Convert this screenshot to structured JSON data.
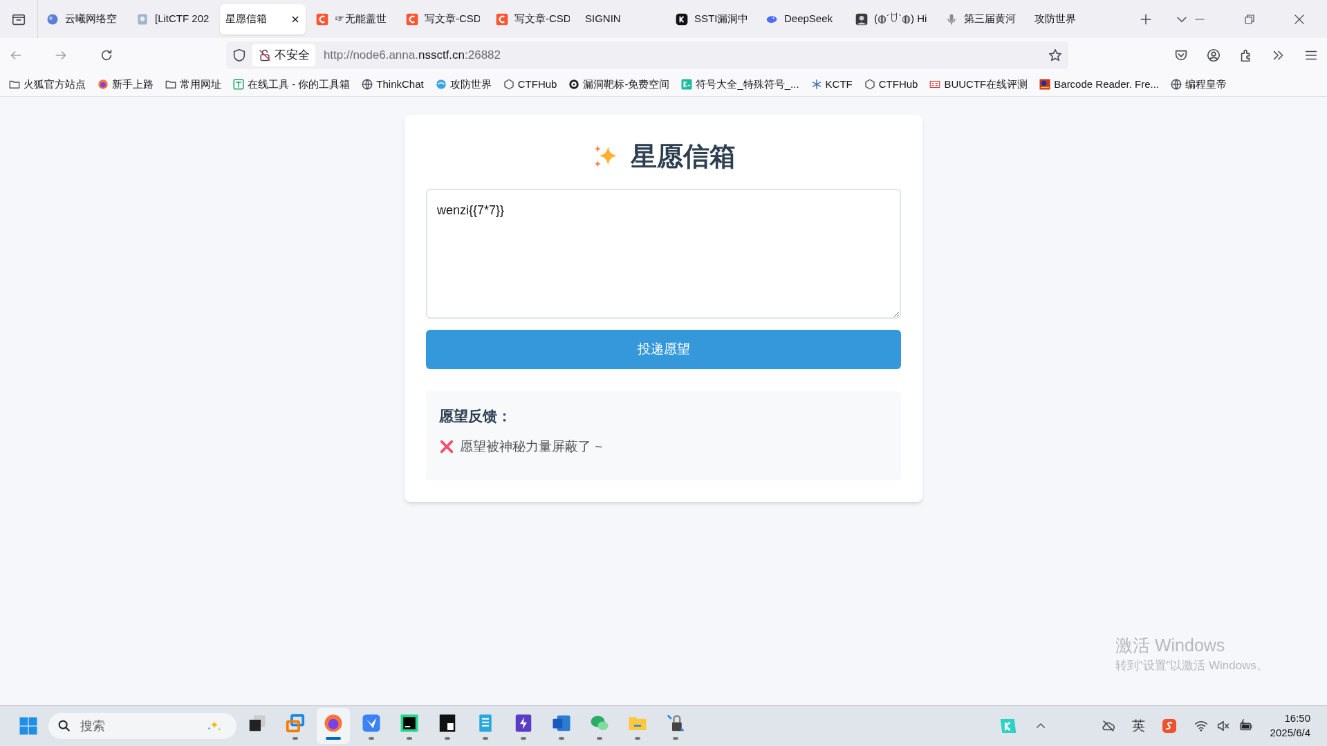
{
  "browser": {
    "tabs": [
      {
        "title": "云曦网络空",
        "kind": "cloud",
        "selected": false
      },
      {
        "title": "[LitCTF 202",
        "kind": "doc",
        "selected": false
      },
      {
        "title": "星愿信箱",
        "kind": "plain",
        "selected": true
      },
      {
        "title": "☞无能盖世",
        "kind": "c",
        "selected": false
      },
      {
        "title": "写文章-CSD",
        "kind": "c",
        "selected": false
      },
      {
        "title": "写文章-CSD",
        "kind": "c",
        "selected": false
      },
      {
        "title": "SIGNIN",
        "kind": "plain",
        "selected": false
      },
      {
        "title": "SSTI漏洞中",
        "kind": "k",
        "selected": false
      },
      {
        "title": "DeepSeek",
        "kind": "whale",
        "selected": false
      },
      {
        "title": "(◍´ꇴ`◍) Hi",
        "kind": "avatar",
        "selected": false
      },
      {
        "title": "第三届黄河",
        "kind": "mic",
        "selected": false
      },
      {
        "title": "攻防世界",
        "kind": "plain",
        "selected": false
      }
    ],
    "security": "不安全",
    "url_host": "http://node6.anna.",
    "url_domain": "nssctf.cn",
    "url_port": ":26882",
    "bookmarks": [
      {
        "label": "火狐官方站点",
        "kind": "folder"
      },
      {
        "label": "新手上路",
        "kind": "firefox"
      },
      {
        "label": "常用网址",
        "kind": "folder"
      },
      {
        "label": "在线工具 - 你的工具箱",
        "kind": "tool"
      },
      {
        "label": "ThinkChat",
        "kind": "globe"
      },
      {
        "label": "攻防世界",
        "kind": "swirl"
      },
      {
        "label": "CTFHub",
        "kind": "hub"
      },
      {
        "label": "漏洞靶标-免费空间",
        "kind": "target"
      },
      {
        "label": "符号大全_特殊符号_...",
        "kind": "ke"
      },
      {
        "label": "KCTF",
        "kind": "snow"
      },
      {
        "label": "CTFHub",
        "kind": "hub"
      },
      {
        "label": "BUUCTF在线评测",
        "kind": "buu"
      },
      {
        "label": "Barcode Reader. Fre...",
        "kind": "barcode"
      },
      {
        "label": "编程皇帝",
        "kind": "globe"
      }
    ]
  },
  "page": {
    "title": "星愿信箱",
    "wish_value": "wenzi{{7*7}}",
    "submit": "投递愿望",
    "feedback": {
      "heading": "愿望反馈：",
      "kind": "error",
      "message": "愿望被神秘力量屏蔽了 ~"
    }
  },
  "activation": {
    "title": "激活 Windows",
    "hint": "转到“设置”以激活 Windows。"
  },
  "taskbar": {
    "search_placeholder": "搜索",
    "apps": [
      {
        "kind": "taskview",
        "running": false,
        "selected": false
      },
      {
        "kind": "remote",
        "running": true,
        "selected": false
      },
      {
        "kind": "firefox",
        "running": true,
        "selected": true
      },
      {
        "kind": "bird",
        "running": true,
        "selected": false
      },
      {
        "kind": "pycharm",
        "running": true,
        "selected": false
      },
      {
        "kind": "bc",
        "running": true,
        "selected": false
      },
      {
        "kind": "notepad",
        "running": true,
        "selected": false
      },
      {
        "kind": "bolt",
        "running": true,
        "selected": false
      },
      {
        "kind": "word",
        "running": true,
        "selected": false
      },
      {
        "kind": "wechat",
        "running": true,
        "selected": false
      },
      {
        "kind": "files",
        "running": true,
        "selected": false
      },
      {
        "kind": "lock",
        "running": true,
        "selected": false
      }
    ],
    "ime": "英",
    "time": "16:50",
    "date": "2025/6/4"
  }
}
